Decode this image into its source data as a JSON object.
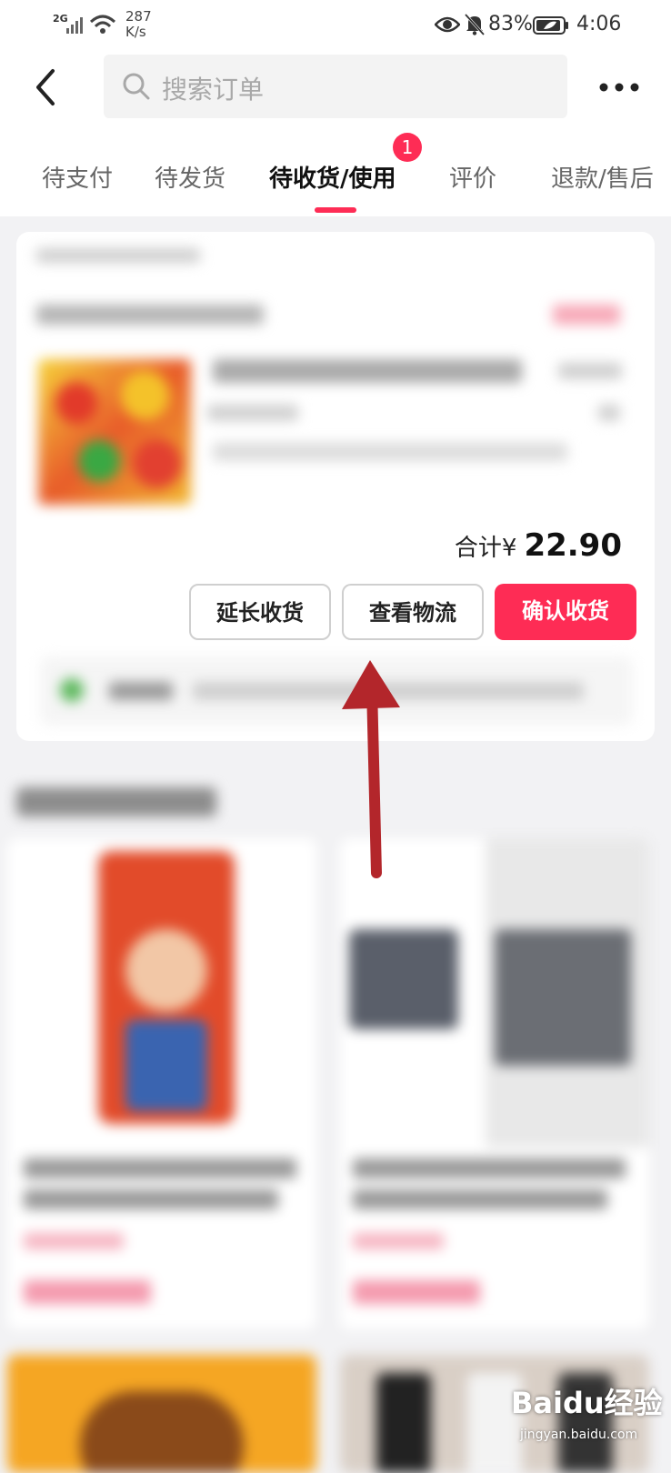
{
  "status_bar": {
    "network": "2G",
    "speed": "287\nK/s",
    "battery": "83%",
    "time": "4:06"
  },
  "header": {
    "search_placeholder": "搜索订单"
  },
  "tabs": [
    {
      "label": "待支付"
    },
    {
      "label": "待发货"
    },
    {
      "label": "待收货/使用",
      "badge": "1"
    },
    {
      "label": "评价"
    },
    {
      "label": "退款/售后"
    }
  ],
  "order": {
    "total_label": "合计¥",
    "total_value": "22.90",
    "actions": {
      "extend": "延长收货",
      "logistics": "查看物流",
      "confirm": "确认收货"
    }
  },
  "watermark": {
    "logo": "Baidu经验",
    "url": "jingyan.baidu.com"
  },
  "colors": {
    "accent": "#fe2c55",
    "arrow": "#b3262b"
  }
}
